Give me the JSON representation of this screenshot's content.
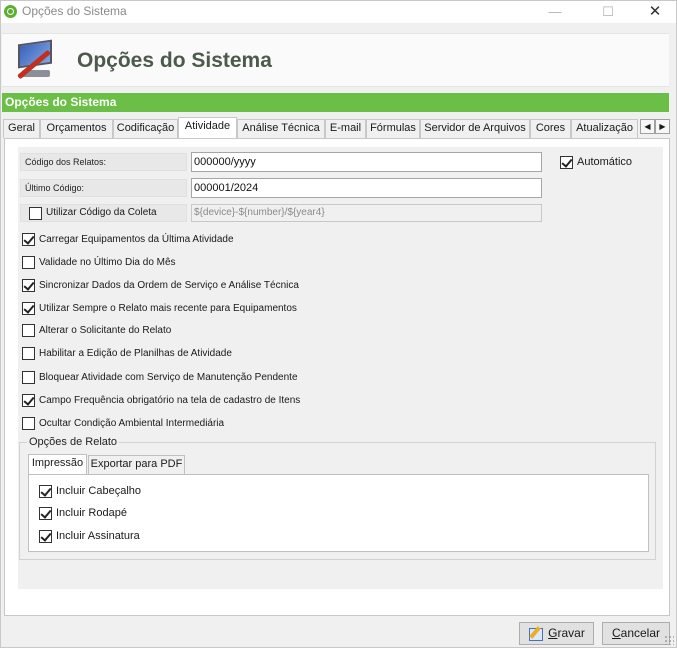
{
  "window": {
    "title": "Opções do Sistema"
  },
  "header": {
    "title": "Opções do Sistema",
    "logo_icon": "computer-tools-icon"
  },
  "section_bar": {
    "label": "Opções do Sistema",
    "color": "#6bbf46"
  },
  "tabs": [
    {
      "label": "Geral"
    },
    {
      "label": "Orçamentos"
    },
    {
      "label": "Codificação"
    },
    {
      "label": "Atividade",
      "active": true
    },
    {
      "label": "Análise Técnica"
    },
    {
      "label": "E-mail"
    },
    {
      "label": "Fórmulas"
    },
    {
      "label": "Servidor de Arquivos"
    },
    {
      "label": "Cores"
    },
    {
      "label": "Atualização"
    }
  ],
  "tab_scroll": {
    "left": "◀",
    "right": "▶"
  },
  "fields": {
    "codigo_relatos": {
      "label": "Código dos Relatos:",
      "value": "000000/yyyy"
    },
    "automatico": {
      "label": "Automático",
      "checked": true
    },
    "ultimo_codigo": {
      "label": "Último Código:",
      "value": "000001/2024"
    },
    "utilizar_codigo_coleta": {
      "label": "Utilizar Código da Coleta",
      "checked": false,
      "placeholder": "${device}-${number}/${year4}"
    }
  },
  "options": [
    {
      "label": "Carregar Equipamentos da Última Atividade",
      "checked": true
    },
    {
      "label": "Validade no Último Dia do Mês",
      "checked": false
    },
    {
      "label": "Sincronizar Dados da Ordem de Serviço e Análise Técnica",
      "checked": true
    },
    {
      "label": "Utilizar Sempre o Relato mais recente para Equipamentos",
      "checked": true
    },
    {
      "label": "Alterar o Solicitante do Relato",
      "checked": false
    },
    {
      "label": "Habilitar a Edição de Planilhas de Atividade",
      "checked": false
    },
    {
      "label": "Bloquear Atividade com Serviço de Manutenção Pendente",
      "checked": false
    },
    {
      "label": "Campo Frequência obrigatório na tela de cadastro de Itens",
      "checked": true
    },
    {
      "label": "Ocultar Condição Ambiental Intermediária",
      "checked": false
    }
  ],
  "relato_group": {
    "title": "Opções de Relato",
    "tabs": [
      {
        "label": "Impressão",
        "active": true
      },
      {
        "label": "Exportar para PDF"
      }
    ],
    "items": [
      {
        "label": "Incluir Cabeçalho",
        "checked": true
      },
      {
        "label": "Incluir Rodapé",
        "checked": true
      },
      {
        "label": "Incluir Assinatura",
        "checked": true
      }
    ]
  },
  "buttons": {
    "save": {
      "label_first": "G",
      "label_rest": "ravar",
      "icon": "pencil-icon"
    },
    "cancel": {
      "label_first": "C",
      "label_rest": "ancelar"
    }
  }
}
